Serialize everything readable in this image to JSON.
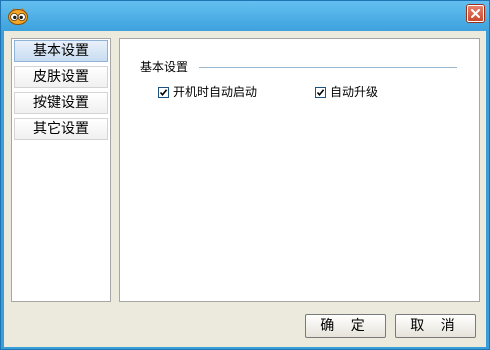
{
  "titlebar": {
    "app_icon": "owl-eyes-icon",
    "close_icon": "close-icon"
  },
  "sidebar": {
    "items": [
      {
        "label": "基本设置",
        "selected": true
      },
      {
        "label": "皮肤设置",
        "selected": false
      },
      {
        "label": "按键设置",
        "selected": false
      },
      {
        "label": "其它设置",
        "selected": false
      }
    ]
  },
  "main": {
    "group_title": "基本设置",
    "options": [
      {
        "label": "开机时自动启动",
        "checked": true
      },
      {
        "label": "自动升级",
        "checked": true
      }
    ]
  },
  "footer": {
    "ok_label": "确 定",
    "cancel_label": "取 消"
  },
  "colors": {
    "titlebar": "#3ea2dd",
    "client_bg": "#ece9dd",
    "selected_item": "#c8dcf1"
  }
}
